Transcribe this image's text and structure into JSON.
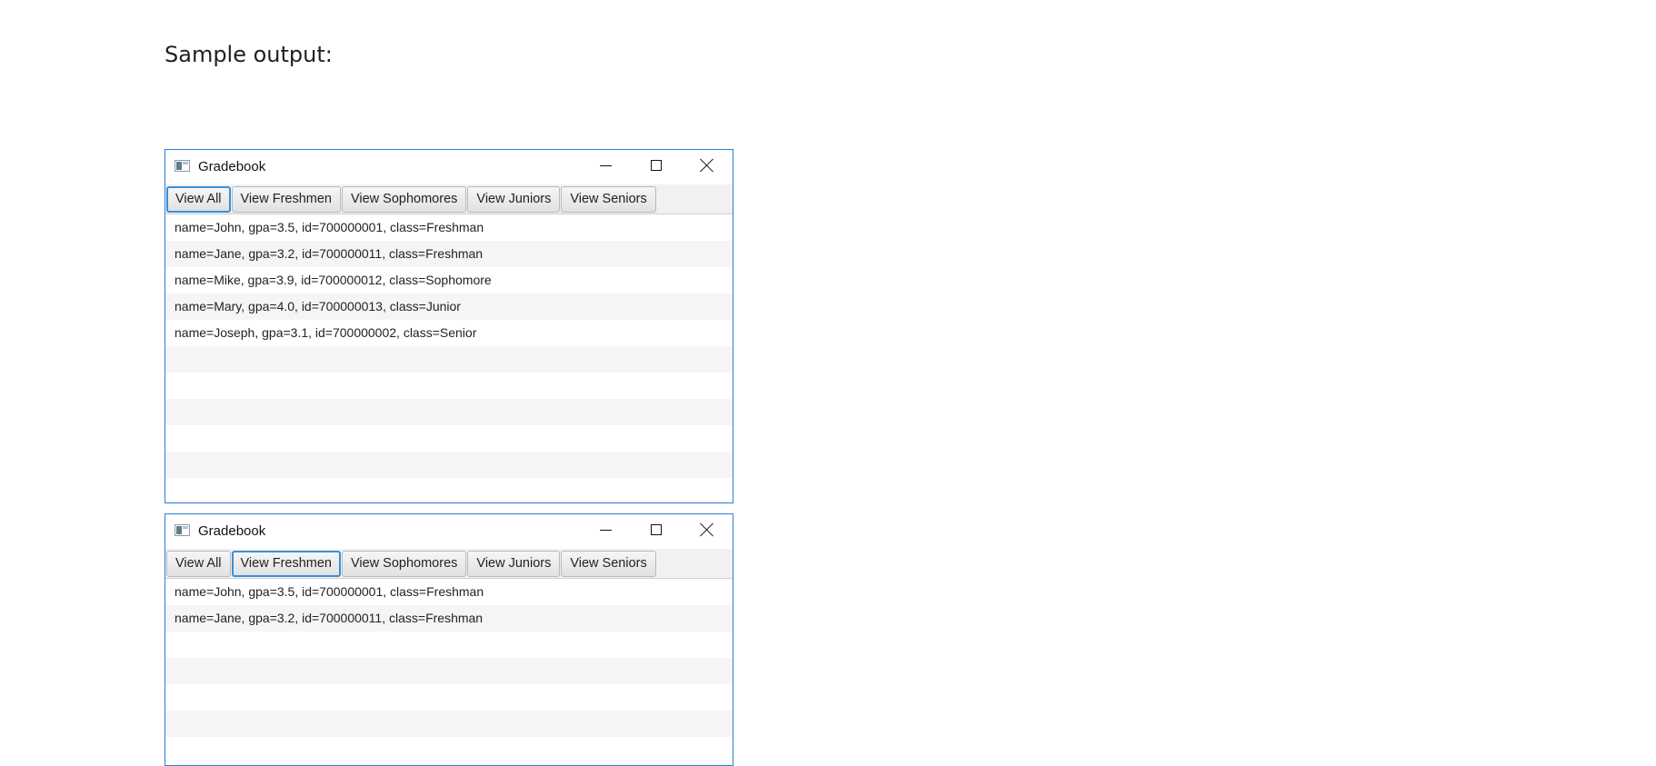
{
  "caption": "Sample output:",
  "windows": [
    {
      "title": "Gradebook",
      "buttons": [
        "View All",
        "View Freshmen",
        "View Sophomores",
        "View Juniors",
        "View Seniors"
      ],
      "focused_button": "View All",
      "rows": [
        "name=John, gpa=3.5, id=700000001, class=Freshman",
        "name=Jane, gpa=3.2, id=700000011, class=Freshman",
        "name=Mike, gpa=3.9, id=700000012, class=Sophomore",
        "name=Mary, gpa=4.0, id=700000013, class=Junior",
        "name=Joseph, gpa=3.1, id=700000002, class=Senior",
        "",
        "",
        "",
        "",
        "",
        ""
      ]
    },
    {
      "title": "Gradebook",
      "buttons": [
        "View All",
        "View Freshmen",
        "View Sophomores",
        "View Juniors",
        "View Seniors"
      ],
      "focused_button": "View Freshmen",
      "rows": [
        "name=John, gpa=3.5, id=700000001, class=Freshman",
        "name=Jane, gpa=3.2, id=700000011, class=Freshman",
        "",
        "",
        "",
        "",
        ""
      ]
    }
  ]
}
